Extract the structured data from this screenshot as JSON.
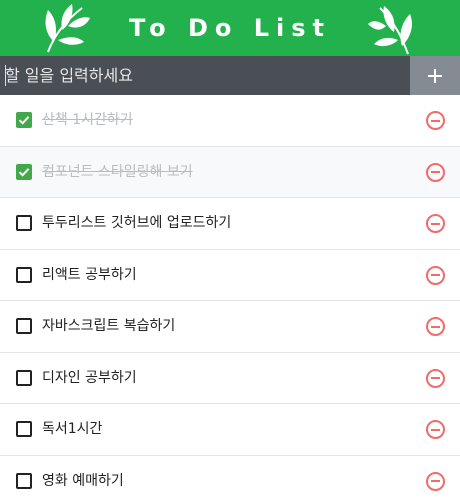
{
  "header": {
    "title": "To Do List",
    "background_color": "#22b14c",
    "decorations": [
      "leaf-icon",
      "leaf-icon"
    ]
  },
  "input": {
    "placeholder": "할 일을 입력하세요",
    "value": "",
    "add_button_icon": "plus-icon"
  },
  "todos": [
    {
      "text": "산책 1시간하기",
      "checked": true
    },
    {
      "text": "컴포넌트 스타일링해 보기",
      "checked": true
    },
    {
      "text": "투두리스트 깃허브에 업로드하기",
      "checked": false
    },
    {
      "text": "리액트 공부하기",
      "checked": false
    },
    {
      "text": "자바스크립트 복습하기",
      "checked": false
    },
    {
      "text": "디자인 공부하기",
      "checked": false
    },
    {
      "text": "독서1시간",
      "checked": false
    },
    {
      "text": "영화 예매하기",
      "checked": false
    }
  ],
  "colors": {
    "accent": "#22b14c",
    "checkbox_checked": "#42a84a",
    "remove": "#f06b6b",
    "input_bar": "#4a4e55",
    "add_button": "#858b93"
  }
}
